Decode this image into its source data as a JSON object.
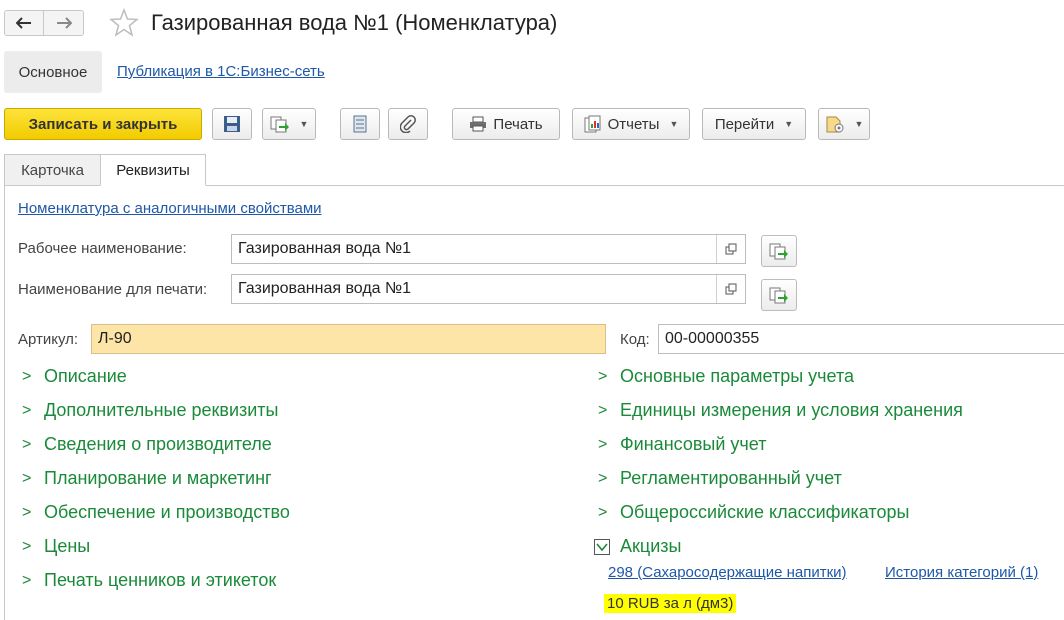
{
  "header": {
    "title": "Газированная вода №1 (Номенклатура)"
  },
  "topnav": {
    "main_label": "Основное",
    "link_label": "Публикация в 1С:Бизнес-сеть"
  },
  "toolbar": {
    "save_close": "Записать и закрыть",
    "print": "Печать",
    "reports": "Отчеты",
    "goto": "Перейти"
  },
  "tabs": [
    {
      "label": "Карточка"
    },
    {
      "label": "Реквизиты"
    }
  ],
  "form": {
    "similar_link": "Номенклатура с аналогичными свойствами",
    "work_name_label": "Рабочее наименование:",
    "work_name_value": "Газированная вода №1",
    "print_name_label": "Наименование для печати:",
    "print_name_value": "Газированная вода №1",
    "article_label": "Артикул:",
    "article_value": "Л-90",
    "code_label": "Код:",
    "code_value": "00-00000355"
  },
  "groups_left": [
    "Описание",
    "Дополнительные реквизиты",
    "Сведения о производителе",
    "Планирование и маркетинг",
    "Обеспечение и производство",
    "Цены",
    "Печать ценников и этикеток"
  ],
  "groups_right": [
    "Основные параметры учета",
    "Единицы измерения и условия хранения",
    "Финансовый учет",
    "Регламентированный учет",
    "Общероссийские классификаторы"
  ],
  "excise": {
    "title": "Акцизы",
    "category_link": "298 (Сахаросодержащие напитки)",
    "history_link": "История категорий (1)",
    "rate": "10 RUB за л (дм3)"
  },
  "colors": {
    "primary_button": "#f5d400",
    "group_text": "#1a8a3a",
    "link": "#1f58a8",
    "article_field": "#fde4a7",
    "rate_highlight": "#ffff00"
  }
}
